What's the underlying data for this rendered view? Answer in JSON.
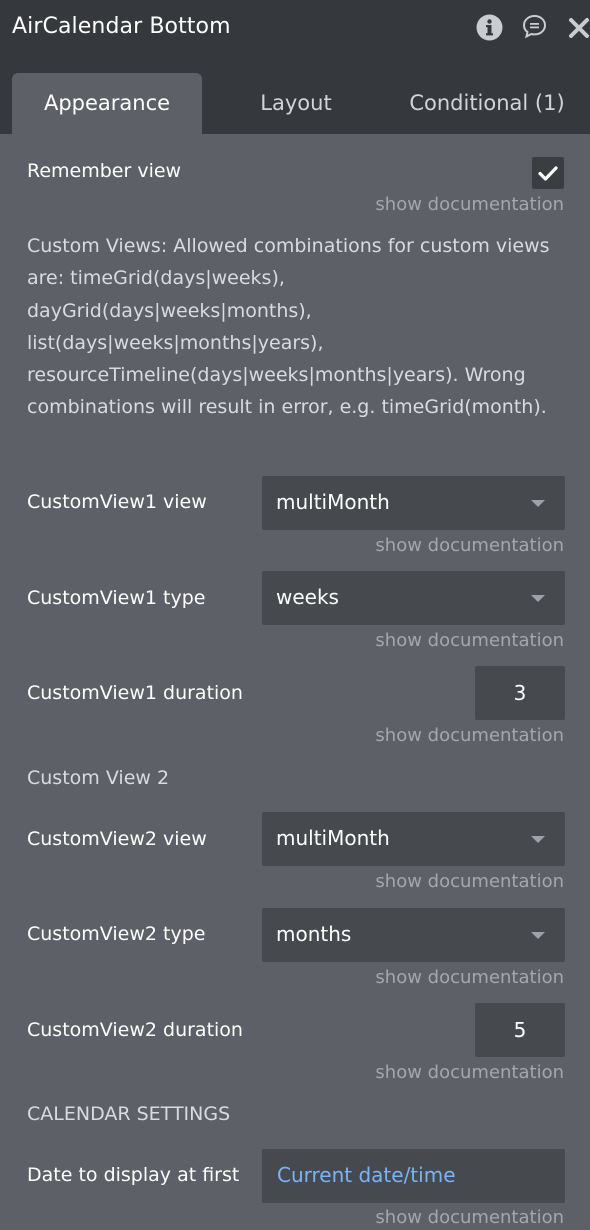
{
  "header": {
    "title": "AirCalendar Bottom",
    "icons": [
      "info-icon",
      "comment-icon",
      "close-icon"
    ]
  },
  "tabs": [
    {
      "label": "Appearance",
      "active": true
    },
    {
      "label": "Layout",
      "active": false
    },
    {
      "label": "Conditional (1)",
      "active": false
    }
  ],
  "remember_view": {
    "label": "Remember view",
    "checked": true
  },
  "doc_link": "show documentation",
  "custom_views_description": "Custom Views: Allowed combinations for custom views are: timeGrid(days|weeks), dayGrid(days|weeks|months), list(days|weeks|months|years), resourceTimeline(days|weeks|months|years). Wrong combinations will result in error, e.g. timeGrid(month).",
  "custom_view1": {
    "view_label": "CustomView1 view",
    "view_value": "multiMonth",
    "type_label": "CustomView1 type",
    "type_value": "weeks",
    "duration_label": "CustomView1 duration",
    "duration_value": "3"
  },
  "custom_view2_heading": "Custom View 2",
  "custom_view2": {
    "view_label": "CustomView2 view",
    "view_value": "multiMonth",
    "type_label": "CustomView2 type",
    "type_value": "months",
    "duration_label": "CustomView2 duration",
    "duration_value": "5"
  },
  "calendar_settings_heading": "CALENDAR SETTINGS",
  "date_display": {
    "label": "Date to display at first",
    "value": "Current date/time"
  },
  "colors": {
    "panel": "#5d6066",
    "header": "#35383d",
    "field": "#464a4f",
    "dynamic_value": "#7ab4f5",
    "muted": "#a4a7ac"
  }
}
